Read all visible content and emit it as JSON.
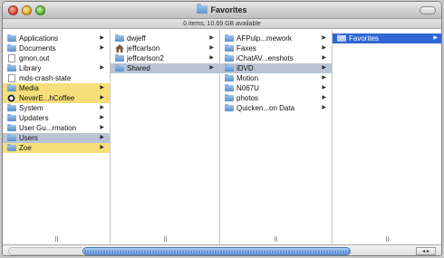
{
  "window": {
    "title": "Favorites",
    "status": "0 items, 10.69 GB available"
  },
  "columns": [
    {
      "items": [
        {
          "label": "Applications",
          "icon": "folder-icon",
          "arrow": true,
          "state": ""
        },
        {
          "label": "Documents",
          "icon": "folder-icon",
          "arrow": true,
          "state": ""
        },
        {
          "label": "gmon.out",
          "icon": "document-icon",
          "arrow": false,
          "state": ""
        },
        {
          "label": "Library",
          "icon": "folder-icon",
          "arrow": true,
          "state": ""
        },
        {
          "label": "mds-crash-state",
          "icon": "document-icon",
          "arrow": false,
          "state": ""
        },
        {
          "label": "Media",
          "icon": "folder-icon",
          "arrow": true,
          "state": "hl"
        },
        {
          "label": "NeverE...hCoffee",
          "icon": "app-icon",
          "arrow": true,
          "state": "hl"
        },
        {
          "label": "System",
          "icon": "folder-icon",
          "arrow": true,
          "state": ""
        },
        {
          "label": "Updaters",
          "icon": "folder-icon",
          "arrow": true,
          "state": ""
        },
        {
          "label": "User Gu...rmation",
          "icon": "folder-icon",
          "arrow": true,
          "state": ""
        },
        {
          "label": "Users",
          "icon": "folder-icon",
          "arrow": true,
          "state": "sel"
        },
        {
          "label": "Zoe",
          "icon": "folder-icon",
          "arrow": true,
          "state": "hl"
        }
      ]
    },
    {
      "items": [
        {
          "label": "dwjeff",
          "icon": "folder-icon",
          "arrow": true,
          "state": ""
        },
        {
          "label": "jeffcarlson",
          "icon": "home-icon",
          "arrow": true,
          "state": ""
        },
        {
          "label": "jeffcarlson2",
          "icon": "folder-icon",
          "arrow": true,
          "state": ""
        },
        {
          "label": "Shared",
          "icon": "folder-icon",
          "arrow": true,
          "state": "sel"
        }
      ]
    },
    {
      "items": [
        {
          "label": "AFPulp...mework",
          "icon": "folder-icon",
          "arrow": true,
          "state": ""
        },
        {
          "label": "Faxes",
          "icon": "folder-icon",
          "arrow": true,
          "state": ""
        },
        {
          "label": "iChatAV...enshots",
          "icon": "folder-icon",
          "arrow": true,
          "state": ""
        },
        {
          "label": "iDVD",
          "icon": "folder-icon",
          "arrow": true,
          "state": "sel"
        },
        {
          "label": "Motion",
          "icon": "folder-icon",
          "arrow": true,
          "state": ""
        },
        {
          "label": "N067U",
          "icon": "folder-icon",
          "arrow": true,
          "state": ""
        },
        {
          "label": "photos",
          "icon": "folder-icon",
          "arrow": true,
          "state": ""
        },
        {
          "label": "Quicken...on Data",
          "icon": "folder-icon",
          "arrow": true,
          "state": ""
        }
      ]
    },
    {
      "items": [
        {
          "label": "Favorites",
          "icon": "folder-icon",
          "arrow": true,
          "state": "active"
        }
      ]
    }
  ],
  "scrollbar": {
    "buttons_label": "◂ ▸"
  }
}
